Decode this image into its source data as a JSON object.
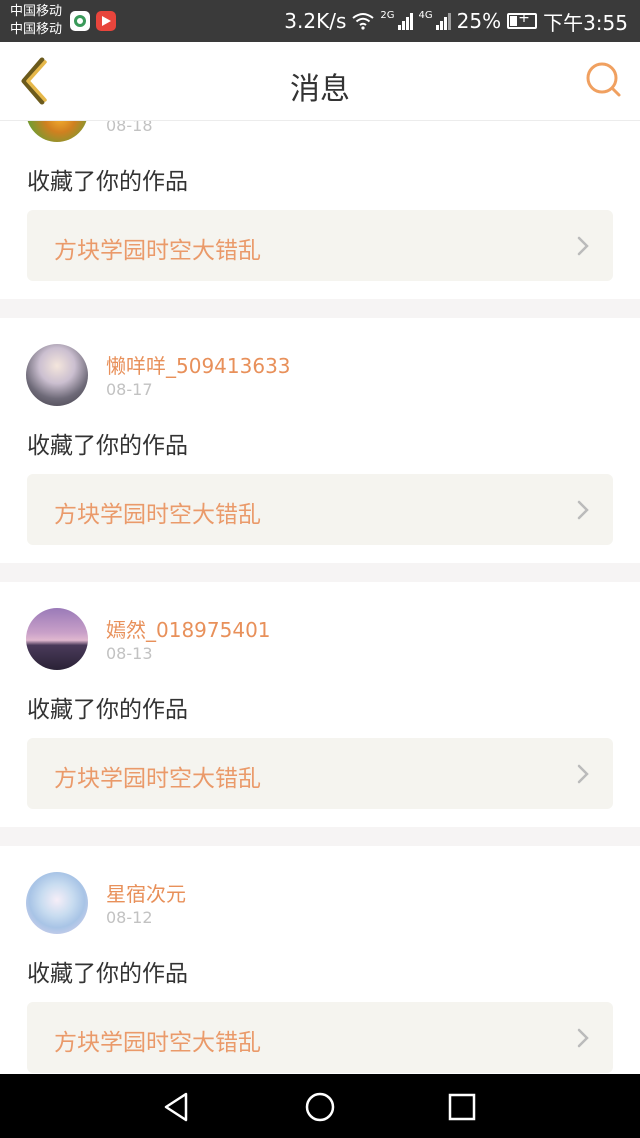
{
  "status_bar": {
    "carrier_1": "中国移动",
    "carrier_2": "中国移动",
    "speed": "3.2K/s",
    "net_1": "2G",
    "net_2": "4G",
    "battery": "25%",
    "time": "下午3:55"
  },
  "header": {
    "title": "消息"
  },
  "notifications": [
    {
      "user": "",
      "date": "08-18",
      "action": "收藏了你的作品",
      "work": "方块学园时空大错乱"
    },
    {
      "user": "懒咩咩_509413633",
      "date": "08-17",
      "action": "收藏了你的作品",
      "work": "方块学园时空大错乱"
    },
    {
      "user": "嫣然_018975401",
      "date": "08-13",
      "action": "收藏了你的作品",
      "work": "方块学园时空大错乱"
    },
    {
      "user": "星宿次元",
      "date": "08-12",
      "action": "收藏了你的作品",
      "work": "方块学园时空大错乱"
    }
  ],
  "colors": {
    "accent": "#e8905a",
    "back_icon": "#e6b84a",
    "search_icon": "#f0a060",
    "card_bg": "#f5f4ef"
  },
  "icons": {
    "back": "chevron-left-icon",
    "search": "search-icon",
    "nav_back": "triangle-back-icon",
    "nav_home": "circle-home-icon",
    "nav_recent": "square-recent-icon"
  }
}
